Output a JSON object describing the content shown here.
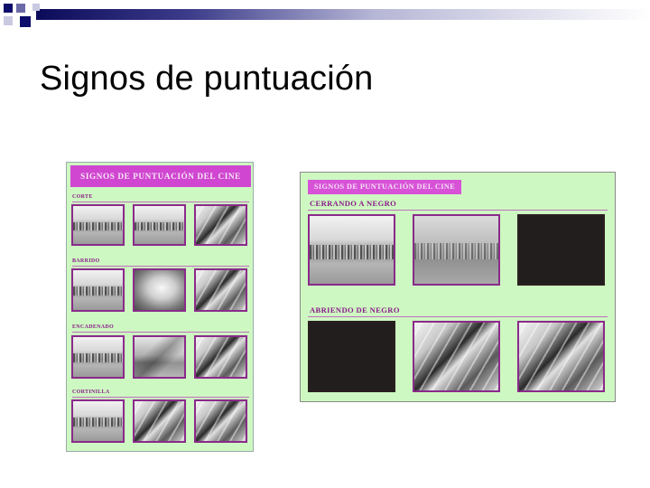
{
  "slide": {
    "title": "Signos de puntuación"
  },
  "left_panel": {
    "header": "SIGNOS DE PUNTUACIÓN DEL CINE",
    "sections": [
      {
        "label": "CORTE"
      },
      {
        "label": "BARRIDO"
      },
      {
        "label": "ENCADENADO"
      },
      {
        "label": "CORTINILLA"
      }
    ]
  },
  "right_panel": {
    "header": "SIGNOS DE PUNTUACIÓN DEL CINE",
    "sections": [
      {
        "label": "CERRANDO A NEGRO"
      },
      {
        "label": "ABRIENDO DE NEGRO"
      }
    ]
  },
  "colors": {
    "panel_bg": "#cef8c2",
    "header_magenta": "#d046d0",
    "frame_purple": "#8a2a8a",
    "title_black": "#000000"
  }
}
